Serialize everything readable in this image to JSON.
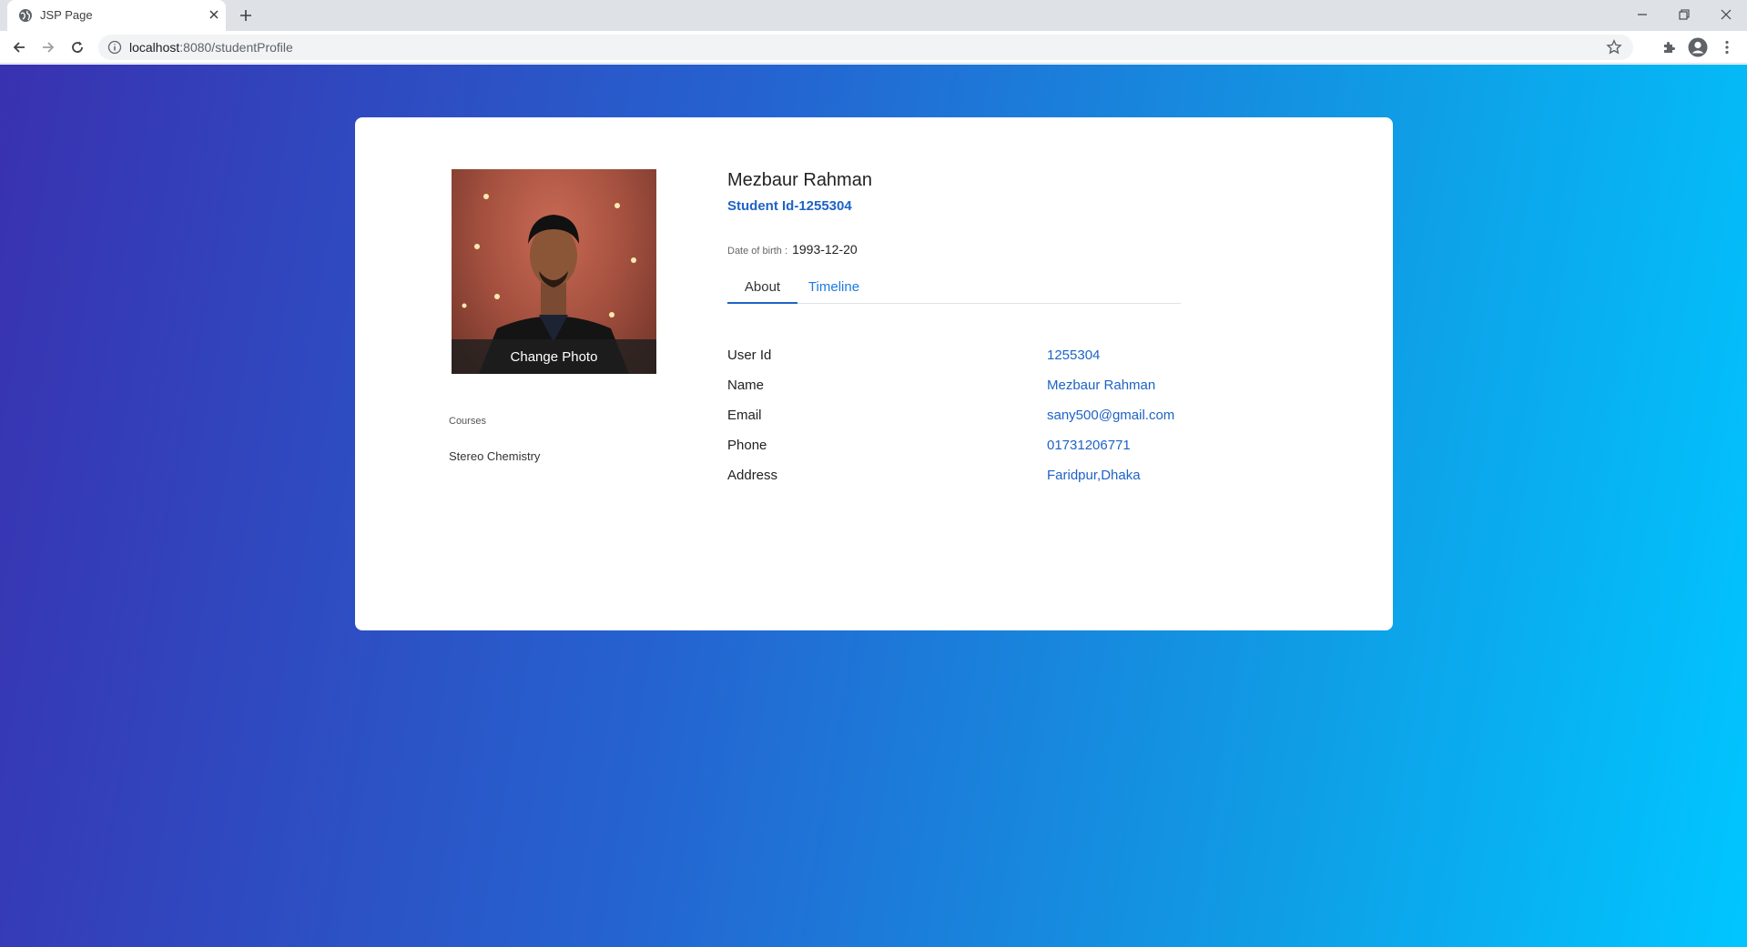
{
  "browser": {
    "tab_title": "JSP Page",
    "url_host": "localhost",
    "url_path": ":8080/studentProfile"
  },
  "profile": {
    "name": "Mezbaur Rahman",
    "student_id": "Student Id-1255304",
    "dob_label": "Date of birth : ",
    "dob_value": "1993-12-20",
    "change_photo": "Change Photo"
  },
  "tabs": {
    "about": "About",
    "timeline": "Timeline"
  },
  "courses": {
    "label": "Courses",
    "items": [
      "Stereo Chemistry"
    ]
  },
  "details": [
    {
      "key": "User Id",
      "value": "1255304"
    },
    {
      "key": "Name",
      "value": "Mezbaur Rahman"
    },
    {
      "key": "Email",
      "value": "sany500@gmail.com"
    },
    {
      "key": "Phone",
      "value": "01731206771"
    },
    {
      "key": "Address",
      "value": "Faridpur,Dhaka"
    }
  ],
  "colors": {
    "accent": "#1e63c6",
    "gradient_start": "#3931b0",
    "gradient_end": "#00c6ff"
  }
}
